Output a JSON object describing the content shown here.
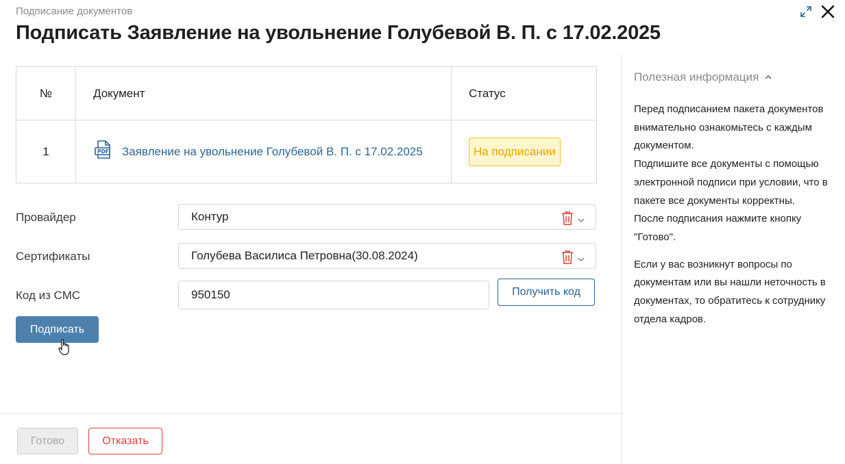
{
  "header": {
    "breadcrumb": "Подписание документов",
    "title": "Подписать Заявление на увольнение Голубевой В. П. с 17.02.2025",
    "expand_icon": "expand-icon",
    "close_icon": "close-icon"
  },
  "table": {
    "columns": [
      "№",
      "Документ",
      "Статус"
    ],
    "rows": [
      {
        "num": "1",
        "file_icon": "pdf-icon",
        "document": "Заявление на увольнение Голубевой В. П. с 17.02.2025",
        "status": "На подписании"
      }
    ]
  },
  "form": {
    "provider_label": "Провайдер",
    "provider_value": "Контур",
    "certificates_label": "Сертификаты",
    "certificates_value": "Голубева Василиса Петровна(30.08.2024)",
    "sms_label": "Код из СМС",
    "sms_value": "950150",
    "get_code_button": "Получить код",
    "sign_button": "Подписать"
  },
  "footer": {
    "done_button": "Готово",
    "reject_button": "Отказать"
  },
  "info": {
    "title": "Полезная информация",
    "paragraphs": [
      "Перед подписанием пакета документов внимательно ознакомьтесь с каждым документом.",
      "Подпишите все документы с помощью электронной подписи при условии, что в пакете все документы корректны.",
      "После подписания нажмите кнопку \"Готово\".",
      "Если у вас возникнут вопросы по документам или вы нашли неточность в документах, то обратитесь к сотруднику отдела кадров."
    ]
  },
  "colors": {
    "accent": "#4d80ad",
    "link": "#2a6496",
    "status_bg": "#fff6cc",
    "status_text": "#e0a800",
    "danger": "#d9413d"
  }
}
